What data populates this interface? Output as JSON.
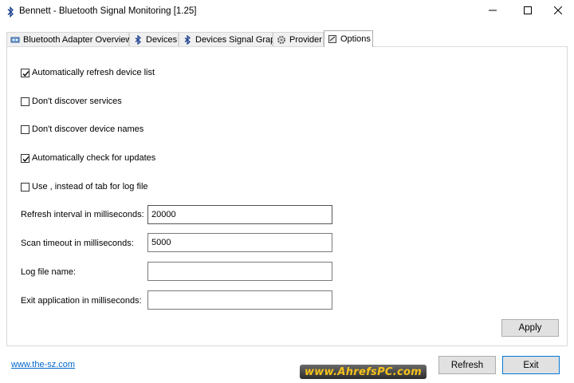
{
  "window": {
    "title": "Bennett - Bluetooth Signal Monitoring [1.25]",
    "controls": {
      "minimize": "minimize-icon",
      "maximize": "maximize-icon",
      "close": "close-icon"
    }
  },
  "tabs": [
    {
      "label": "Bluetooth Adapter Overview",
      "icon": "adapter-icon"
    },
    {
      "label": "Devices",
      "icon": "bluetooth-icon"
    },
    {
      "label": "Devices Signal Graph",
      "icon": "bluetooth-icon"
    },
    {
      "label": "Provider",
      "icon": "gear-icon"
    },
    {
      "label": "Options",
      "icon": "options-icon",
      "active": true
    }
  ],
  "options": {
    "checkboxes": [
      {
        "label": "Automatically refresh device list",
        "checked": true
      },
      {
        "label": "Don't discover services",
        "checked": false
      },
      {
        "label": "Don't discover device names",
        "checked": false
      },
      {
        "label": "Automatically check for updates",
        "checked": true
      },
      {
        "label": "Use , instead of tab for log file",
        "checked": false
      }
    ],
    "fields": [
      {
        "label": "Refresh interval in milliseconds:",
        "value": "20000"
      },
      {
        "label": "Scan timeout in milliseconds:",
        "value": "5000"
      },
      {
        "label": "Log file name:",
        "value": ""
      },
      {
        "label": "Exit application in milliseconds:",
        "value": ""
      }
    ],
    "apply_label": "Apply"
  },
  "footer": {
    "link": "www.the-sz.com",
    "refresh_label": "Refresh",
    "exit_label": "Exit",
    "watermark": "www.AhrefsPC.com"
  },
  "colors": {
    "link": "#0066cc",
    "default_button_border": "#0078d7",
    "watermark_text": "#f6c21a"
  }
}
